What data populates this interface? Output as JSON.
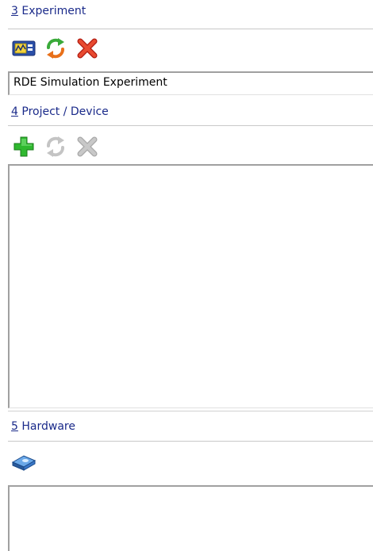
{
  "experiment_section": {
    "number": "3",
    "label": " Experiment",
    "items": [
      "RDE Simulation Experiment"
    ]
  },
  "project_section": {
    "number": "4",
    "label": " Project / Device"
  },
  "hardware_section": {
    "number": "5",
    "label": " Hardware"
  },
  "icons": {
    "experiment_toolbar": [
      "experiment-device-icon",
      "refresh-icon",
      "delete-icon"
    ],
    "project_toolbar": [
      "add-icon",
      "refresh-icon-disabled",
      "delete-icon-disabled"
    ],
    "hardware_toolbar": [
      "hardware-device-icon"
    ]
  },
  "colors": {
    "header_text": "#1a2a8a",
    "add_green": "#2fb82f",
    "delete_red": "#e02a1a",
    "refresh_green": "#3aaa3a",
    "refresh_orange": "#e8701a",
    "disabled_gray": "#bdbdbd",
    "device_blue": "#3a78c8"
  }
}
